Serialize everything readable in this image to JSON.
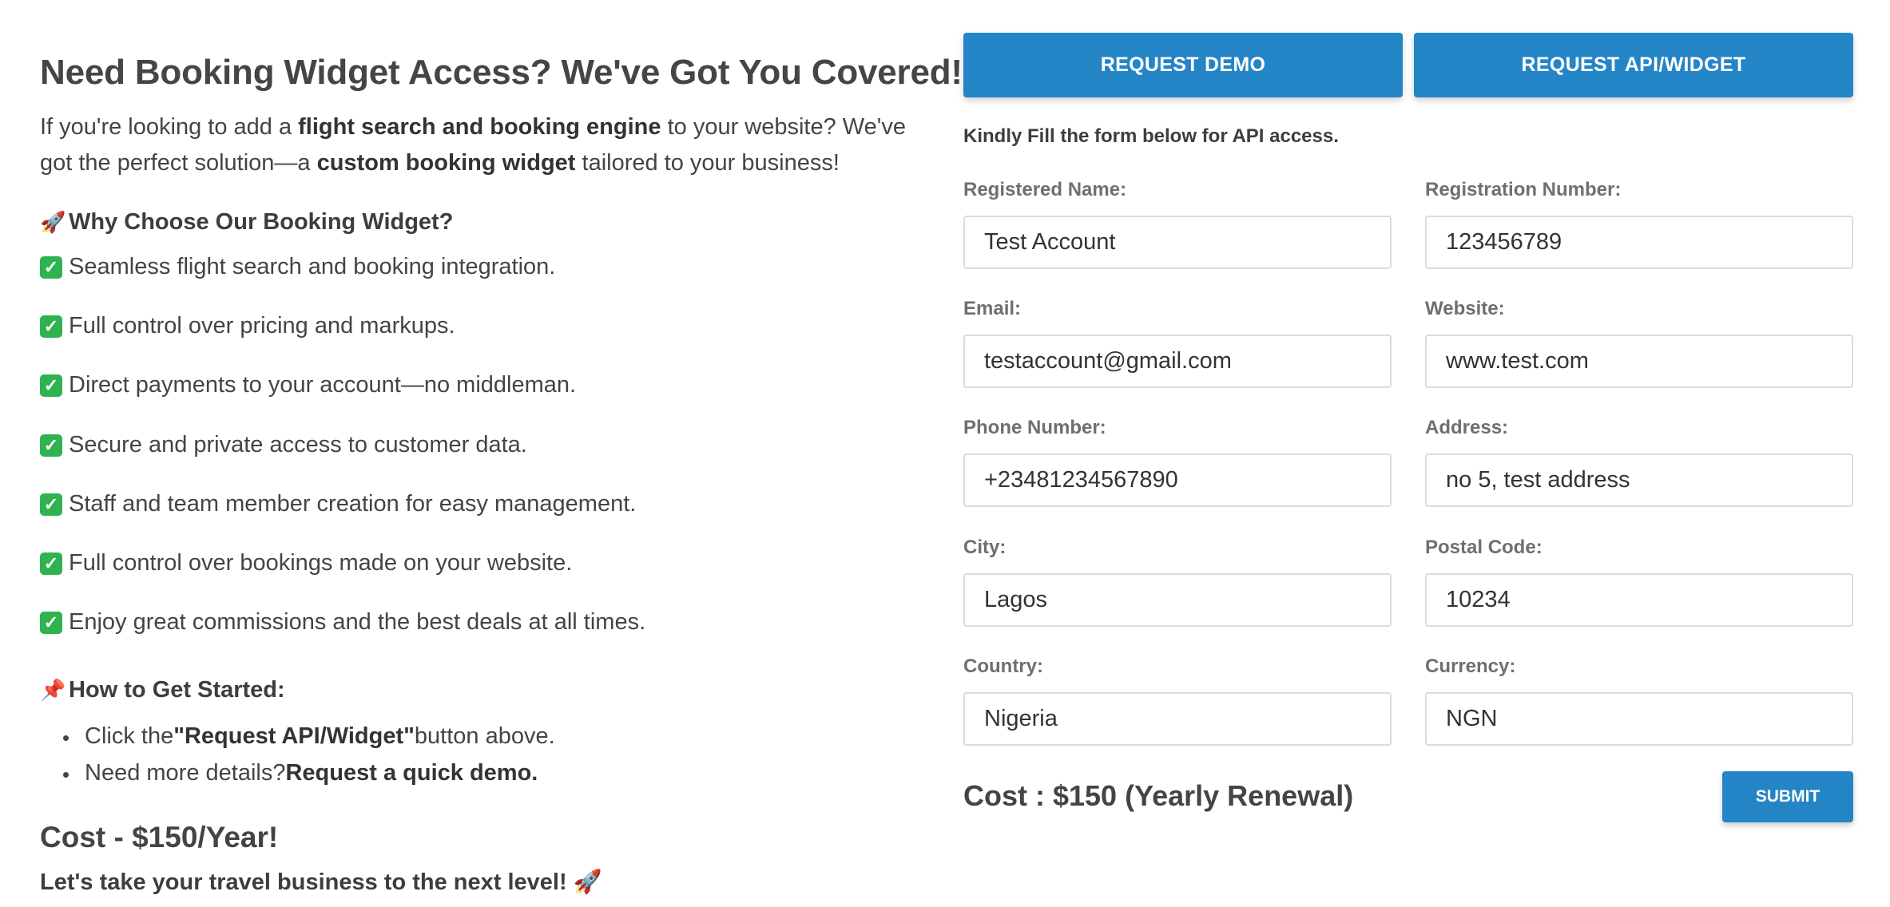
{
  "left": {
    "heading": "Need Booking Widget Access? We've Got You Covered!",
    "intro": {
      "p1": "If you're looking to add a ",
      "b1": "flight search and booking engine",
      "p2": " to your website? We've got the perfect solution—a ",
      "b2": "custom booking widget",
      "p3": " tailored to your business!"
    },
    "why_title": "Why Choose Our Booking Widget?",
    "why_icon": "rocket-icon",
    "features": [
      "Seamless flight search and booking integration.",
      "Full control over pricing and markups.",
      "Direct payments to your account—no middleman.",
      "Secure and private access to customer data.",
      "Staff and team member creation for easy management.",
      "Full control over bookings made on your website.",
      "Enjoy great commissions and the best deals at all times."
    ],
    "feature_icon": "check-mark-icon",
    "start_title": "How to Get Started:",
    "start_icon": "pushpin-icon",
    "steps": [
      {
        "pre": "Click the ",
        "bold": "\"Request API/Widget\"",
        "post": " button above."
      },
      {
        "pre": "Need more details? ",
        "bold": "Request a quick demo.",
        "post": ""
      }
    ],
    "cost": "Cost - $150/Year!",
    "tagline": "Let's take your travel business to the next level!"
  },
  "right": {
    "request_demo_label": "REQUEST DEMO",
    "request_api_label": "REQUEST API/WIDGET",
    "form_note": "Kindly Fill the form below for API access.",
    "fields": {
      "registered_name": {
        "label": "Registered Name:",
        "value": "Test Account"
      },
      "registration_number": {
        "label": "Registration Number:",
        "value": "123456789"
      },
      "email": {
        "label": "Email:",
        "value": "testaccount@gmail.com"
      },
      "website": {
        "label": "Website:",
        "value": "www.test.com"
      },
      "phone": {
        "label": "Phone Number:",
        "value": "+23481234567890"
      },
      "address": {
        "label": "Address:",
        "value": "no 5, test address"
      },
      "city": {
        "label": "City:",
        "value": "Lagos"
      },
      "postal_code": {
        "label": "Postal Code:",
        "value": "10234"
      },
      "country": {
        "label": "Country:",
        "value": "Nigeria"
      },
      "currency": {
        "label": "Currency:",
        "value": "NGN"
      }
    },
    "cost": "Cost : $150 (Yearly Renewal)",
    "submit_label": "SUBMIT"
  },
  "colors": {
    "accent": "#2485c6",
    "check": "#2fb350",
    "text": "#444444",
    "label": "#6f6f6f",
    "border": "#dcdcdc"
  }
}
